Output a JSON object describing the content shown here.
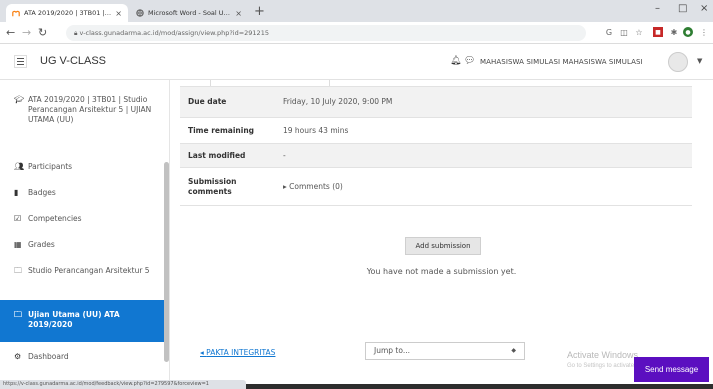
{
  "browser": {
    "tabs": [
      {
        "label": "ATA 2019/2020 | 3TB01 | Studio",
        "active": true
      },
      {
        "label": "Microsoft Word - Soal UU ATA 20",
        "active": false
      }
    ],
    "new_tab": "+",
    "window_controls": [
      "–",
      "□",
      "×"
    ],
    "url": "v-class.gunadarma.ac.id/mod/assign/view.php?id=291215",
    "status_url": "https://v-class.gunadarma.ac.id/mod/feedback/view.php?id=279597&forceview=1"
  },
  "navbar": {
    "brand": "UG V-CLASS",
    "user": "MAHASISWA SIMULASI MAHASISWA SIMULASI"
  },
  "sidebar": {
    "course": "ATA 2019/2020 | 3TB01 | Studio Perancangan Arsitektur 5 | UJIAN UTAMA (UU)",
    "participants": "Participants",
    "badges": "Badges",
    "competencies": "Competencies",
    "grades": "Grades",
    "section1": "Studio Perancangan Arsitektur 5",
    "section2": "Ujian Utama (UU) ATA 2019/2020",
    "dashboard": "Dashboard"
  },
  "status": {
    "due_label": "Due date",
    "due_value": "Friday, 10 July 2020, 9:00 PM",
    "remaining_label": "Time remaining",
    "remaining_value": "19 hours 43 mins",
    "modified_label": "Last modified",
    "modified_value": "-",
    "comments_label": "Submission comments",
    "comments_value": "Comments (0)"
  },
  "actions": {
    "add_submission": "Add submission",
    "no_submission": "You have not made a submission yet."
  },
  "footer_nav": {
    "prev_link": "PAKTA INTEGRITAS",
    "jump_to": "Jump to..."
  },
  "windows_watermark": {
    "line1": "Activate Windows",
    "line2": "Go to Settings to activate Windows."
  },
  "send_message": "Send message"
}
